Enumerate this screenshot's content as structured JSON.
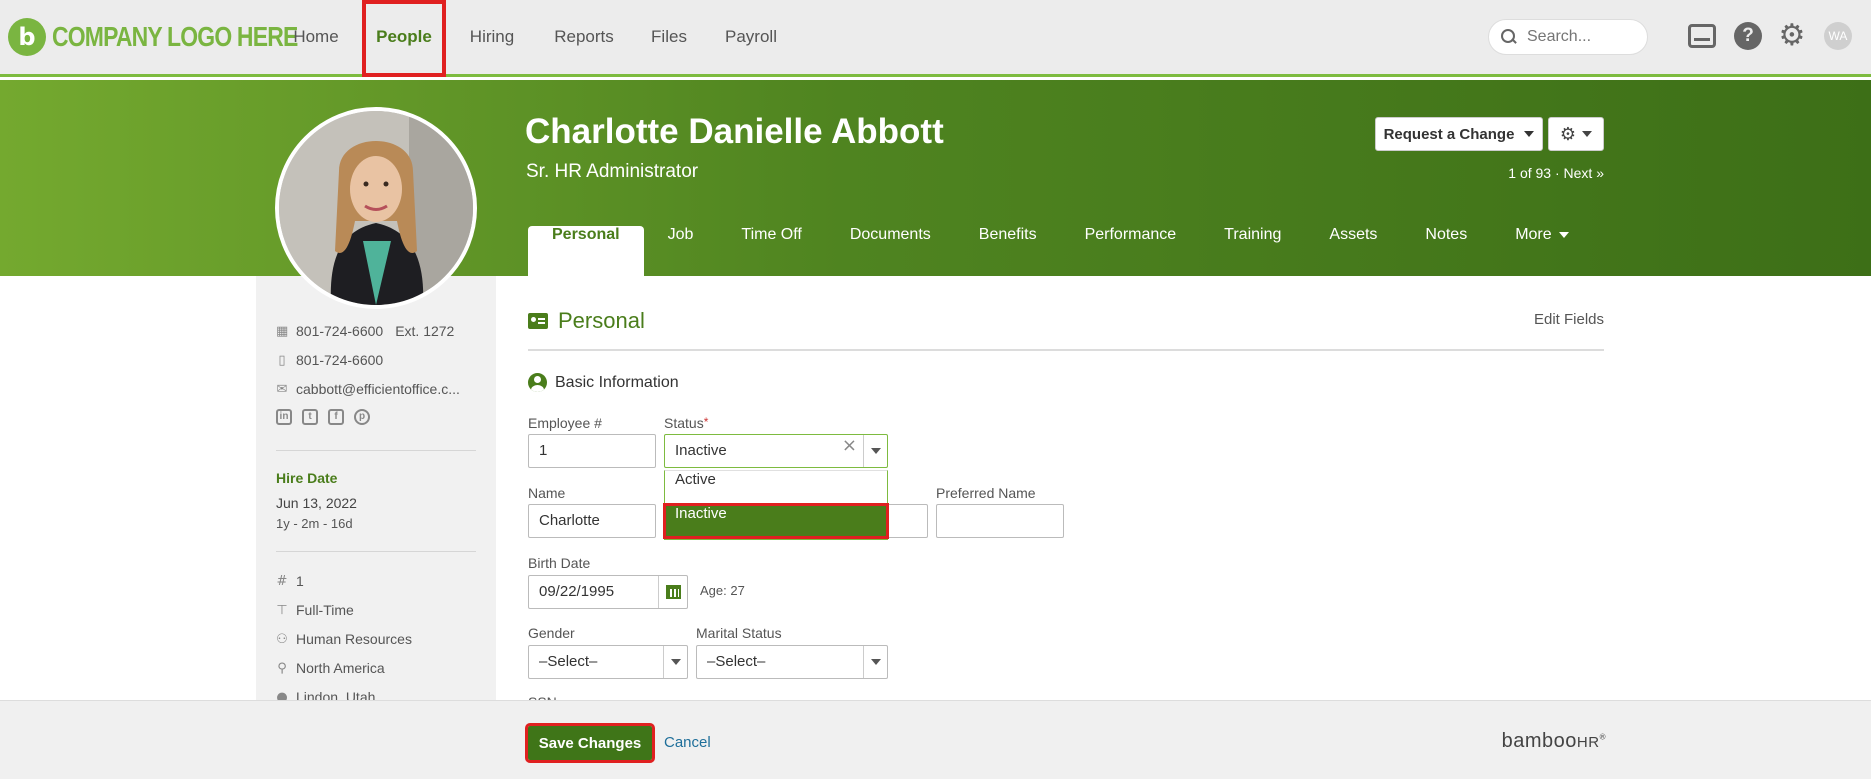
{
  "logo": {
    "mark": "b",
    "text": "COMPANY LOGO HERE"
  },
  "nav": {
    "items": [
      {
        "label": "Home"
      },
      {
        "label": "People"
      },
      {
        "label": "Hiring"
      },
      {
        "label": "Reports"
      },
      {
        "label": "Files"
      },
      {
        "label": "Payroll"
      }
    ],
    "active": "People",
    "search_placeholder": "Search...",
    "user_initials": "WA",
    "icons": [
      "inbox-icon",
      "help-icon",
      "gear-icon",
      "avatar"
    ]
  },
  "employee": {
    "name": "Charlotte Danielle Abbott",
    "title": "Sr. HR Administrator",
    "request_change_label": "Request a Change",
    "pager": "1 of 93 · Next »"
  },
  "tabs": [
    {
      "label": "Personal"
    },
    {
      "label": "Job"
    },
    {
      "label": "Time Off"
    },
    {
      "label": "Documents"
    },
    {
      "label": "Benefits"
    },
    {
      "label": "Performance"
    },
    {
      "label": "Training"
    },
    {
      "label": "Assets"
    },
    {
      "label": "Notes"
    },
    {
      "label": "More"
    }
  ],
  "sidebar": {
    "work_phone": "801-724-6600",
    "ext": "Ext. 1272",
    "mobile_phone": "801-724-6600",
    "email": "cabbott@efficientoffice.c...",
    "social": [
      "in",
      "t",
      "f",
      "p"
    ],
    "hire_label": "Hire Date",
    "hire_date": "Jun 13, 2022",
    "hire_duration": "1y - 2m - 16d",
    "employee_number": "1",
    "employment_type": "Full-Time",
    "department": "Human Resources",
    "division": "North America",
    "location": "Lindon, Utah"
  },
  "section": {
    "title": "Personal",
    "edit_fields_label": "Edit Fields",
    "subsection": "Basic Information"
  },
  "form": {
    "employee_number": {
      "label": "Employee #",
      "value": "1"
    },
    "status": {
      "label": "Status",
      "required": "*",
      "value": "Inactive",
      "options": [
        "Active",
        "Inactive"
      ]
    },
    "name": {
      "label": "Name",
      "value": "Charlotte"
    },
    "preferred_name": {
      "label": "Preferred Name",
      "value": ""
    },
    "birth_date": {
      "label": "Birth Date",
      "value": "09/22/1995",
      "age": "Age: 27"
    },
    "gender": {
      "label": "Gender",
      "value": "–Select–"
    },
    "marital_status": {
      "label": "Marital Status",
      "value": "–Select–"
    },
    "ssn": {
      "label": "SSN"
    }
  },
  "footer": {
    "save_label": "Save Changes",
    "cancel_label": "Cancel",
    "brand": "bamboo",
    "brand_suffix": "HR",
    "brand_mark": "®"
  },
  "colors": {
    "brand_green": "#4a7d1b",
    "light_green": "#7ab541",
    "highlight_red": "#e02020",
    "link_blue": "#1f6f9a"
  }
}
